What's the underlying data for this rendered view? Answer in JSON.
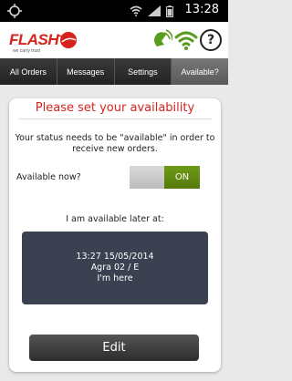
{
  "status_bar": {
    "time": "13:28",
    "icons": [
      "target-icon",
      "wifi-icon",
      "signal-icon",
      "battery-icon"
    ]
  },
  "header": {
    "brand_name": "FLASH",
    "brand_tagline": "we carry trust",
    "icons": [
      "location-icon",
      "wifi-icon",
      "help-icon"
    ],
    "help_symbol": "?"
  },
  "tabs": [
    {
      "label": "All Orders",
      "active": false
    },
    {
      "label": "Messages",
      "active": false
    },
    {
      "label": "Settings",
      "active": false
    },
    {
      "label": "Available?",
      "active": true
    }
  ],
  "card": {
    "title": "Please set your availability",
    "message": "Your status needs to be \"available\" in order to receive new orders.",
    "available_label": "Available now?",
    "toggle_state": "ON",
    "later_label": "I am available later at:",
    "later_box": {
      "datetime": "13:27 15/05/2014",
      "location": "Agra 02 / E",
      "note": "I'm here"
    },
    "edit_label": "Edit"
  },
  "colors": {
    "accent": "#d6241d",
    "toggle_on": "#6f9a17",
    "later_box": "#3b4150",
    "tab_bar": "#2b2b2b"
  }
}
